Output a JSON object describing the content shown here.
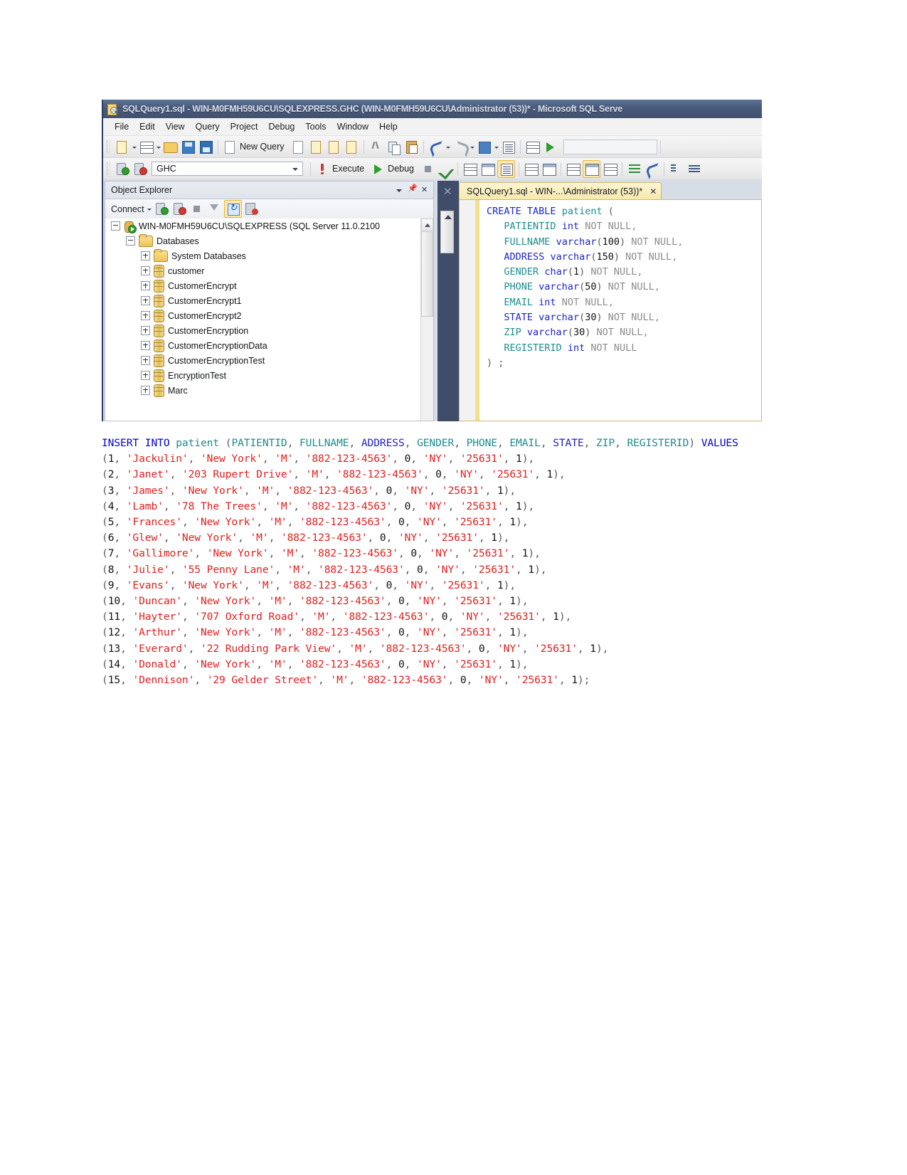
{
  "window": {
    "title": "SQLQuery1.sql - WIN-M0FMH59U6CU\\SQLEXPRESS.GHC (WIN-M0FMH59U6CU\\Administrator (53))* - Microsoft SQL Serve",
    "icon": "sql-file-icon"
  },
  "menu": {
    "items": [
      {
        "label": "File"
      },
      {
        "label": "Edit"
      },
      {
        "label": "View"
      },
      {
        "label": "Query"
      },
      {
        "label": "Project"
      },
      {
        "label": "Debug"
      },
      {
        "label": "Tools"
      },
      {
        "label": "Window"
      },
      {
        "label": "Help"
      }
    ]
  },
  "toolbar_main": {
    "new_query_label": "New Query",
    "search_value": ""
  },
  "toolbar_sql": {
    "database_combo_value": "GHC",
    "execute_label": "Execute",
    "debug_label": "Debug"
  },
  "object_explorer": {
    "title": "Object Explorer",
    "connect_label": "Connect",
    "tree": [
      {
        "label": "WIN-M0FMH59U6CU\\SQLEXPRESS (SQL Server 11.0.2100",
        "indent": 0,
        "state": "minus",
        "icon": "server-icon"
      },
      {
        "label": "Databases",
        "indent": 1,
        "state": "minus",
        "icon": "folder-icon"
      },
      {
        "label": "System Databases",
        "indent": 2,
        "state": "plus",
        "icon": "folder-icon"
      },
      {
        "label": "customer",
        "indent": 2,
        "state": "plus",
        "icon": "database-icon"
      },
      {
        "label": "CustomerEncrypt",
        "indent": 2,
        "state": "plus",
        "icon": "database-icon"
      },
      {
        "label": "CustomerEncrypt1",
        "indent": 2,
        "state": "plus",
        "icon": "database-icon"
      },
      {
        "label": "CustomerEncrypt2",
        "indent": 2,
        "state": "plus",
        "icon": "database-icon"
      },
      {
        "label": "CustomerEncryption",
        "indent": 2,
        "state": "plus",
        "icon": "database-icon"
      },
      {
        "label": "CustomerEncryptionData",
        "indent": 2,
        "state": "plus",
        "icon": "database-icon"
      },
      {
        "label": "CustomerEncryptionTest",
        "indent": 2,
        "state": "plus",
        "icon": "database-icon"
      },
      {
        "label": "EncryptionTest",
        "indent": 2,
        "state": "plus",
        "icon": "database-icon"
      },
      {
        "label": "Marc",
        "indent": 2,
        "state": "plus",
        "icon": "database-icon"
      }
    ]
  },
  "editor": {
    "tab_label": "SQLQuery1.sql - WIN-...\\Administrator (53))*",
    "tab_close": "✕",
    "create_table": {
      "line1": {
        "kw1": "CREATE",
        "kw2": "TABLE",
        "name": "patient",
        "open": "("
      },
      "columns": [
        {
          "name": "PATIENTID",
          "name_style": "id",
          "type": "int",
          "size": "",
          "null": "NOT NULL",
          "comma": ","
        },
        {
          "name": "FULLNAME",
          "name_style": "id",
          "type": "varchar",
          "size": "100",
          "null": "NOT NULL",
          "comma": ","
        },
        {
          "name": "ADDRESS",
          "name_style": "idb",
          "type": "varchar",
          "size": "150",
          "null": "NOT NULL",
          "comma": ","
        },
        {
          "name": "GENDER",
          "name_style": "id",
          "type": "char",
          "size": "1",
          "null": "NOT NULL",
          "comma": ","
        },
        {
          "name": "PHONE",
          "name_style": "id",
          "type": "varchar",
          "size": "50",
          "null": "NOT NULL",
          "comma": ","
        },
        {
          "name": "EMAIL",
          "name_style": "id",
          "type": "int",
          "size": "",
          "null": "NOT NULL",
          "comma": ","
        },
        {
          "name": "STATE",
          "name_style": "idb",
          "type": "varchar",
          "size": "30",
          "null": "NOT NULL",
          "comma": ","
        },
        {
          "name": "ZIP",
          "name_style": "id",
          "type": "varchar",
          "size": "30",
          "null": "NOT NULL",
          "comma": ","
        },
        {
          "name": "REGISTERID",
          "name_style": "id",
          "type": "int",
          "size": "",
          "null": "NOT NULL",
          "comma": ""
        }
      ],
      "closing": ") ;"
    }
  },
  "sql_listing": {
    "statement": {
      "kw_insert": "INSERT INTO",
      "table": "patient",
      "columns": [
        "PATIENTID",
        "FULLNAME",
        "ADDRESS",
        "GENDER",
        "PHONE",
        "EMAIL",
        "STATE",
        "ZIP",
        "REGISTERID"
      ],
      "column_styles": [
        "id",
        "id",
        "idb",
        "id",
        "id",
        "id",
        "idb",
        "id",
        "id"
      ],
      "kw_values": "VALUES",
      "terminator": ";"
    },
    "rows": [
      {
        "id": "1",
        "name": "Jackulin",
        "address": "New York",
        "gender": "M",
        "phone": "882-123-4563",
        "email": "0",
        "state": "NY",
        "zip": "25631",
        "registerid": "1"
      },
      {
        "id": "2",
        "name": "Janet",
        "address": "203 Rupert Drive",
        "gender": "M",
        "phone": "882-123-4563",
        "email": "0",
        "state": "NY",
        "zip": "25631",
        "registerid": "1"
      },
      {
        "id": "3",
        "name": "James",
        "address": "New York",
        "gender": "M",
        "phone": "882-123-4563",
        "email": "0",
        "state": "NY",
        "zip": "25631",
        "registerid": "1"
      },
      {
        "id": "4",
        "name": "Lamb",
        "address": "78 The Trees",
        "gender": "M",
        "phone": "882-123-4563",
        "email": "0",
        "state": "NY",
        "zip": "25631",
        "registerid": "1"
      },
      {
        "id": "5",
        "name": "Frances",
        "address": "New York",
        "gender": "M",
        "phone": "882-123-4563",
        "email": "0",
        "state": "NY",
        "zip": "25631",
        "registerid": "1"
      },
      {
        "id": "6",
        "name": "Glew",
        "address": "New York",
        "gender": "M",
        "phone": "882-123-4563",
        "email": "0",
        "state": "NY",
        "zip": "25631",
        "registerid": "1"
      },
      {
        "id": "7",
        "name": "Gallimore",
        "address": "New York",
        "gender": "M",
        "phone": "882-123-4563",
        "email": "0",
        "state": "NY",
        "zip": "25631",
        "registerid": "1"
      },
      {
        "id": "8",
        "name": "Julie",
        "address": "55 Penny Lane",
        "gender": "M",
        "phone": "882-123-4563",
        "email": "0",
        "state": "NY",
        "zip": "25631",
        "registerid": "1"
      },
      {
        "id": "9",
        "name": "Evans",
        "address": "New York",
        "gender": "M",
        "phone": "882-123-4563",
        "email": "0",
        "state": "NY",
        "zip": "25631",
        "registerid": "1"
      },
      {
        "id": "10",
        "name": "Duncan",
        "address": "New York",
        "gender": "M",
        "phone": "882-123-4563",
        "email": "0",
        "state": "NY",
        "zip": "25631",
        "registerid": "1"
      },
      {
        "id": "11",
        "name": "Hayter",
        "address": "707 Oxford Road",
        "gender": "M",
        "phone": "882-123-4563",
        "email": "0",
        "state": "NY",
        "zip": "25631",
        "registerid": "1"
      },
      {
        "id": "12",
        "name": "Arthur",
        "address": "New York",
        "gender": "M",
        "phone": "882-123-4563",
        "email": "0",
        "state": "NY",
        "zip": "25631",
        "registerid": "1"
      },
      {
        "id": "13",
        "name": "Everard",
        "address": "22 Rudding Park View",
        "gender": "M",
        "phone": "882-123-4563",
        "email": "0",
        "state": "NY",
        "zip": "25631",
        "registerid": "1"
      },
      {
        "id": "14",
        "name": "Donald",
        "address": "New York",
        "gender": "M",
        "phone": "882-123-4563",
        "email": "0",
        "state": "NY",
        "zip": "25631",
        "registerid": "1"
      },
      {
        "id": "15",
        "name": "Dennison",
        "address": "29 Gelder Street",
        "gender": "M",
        "phone": "882-123-4563",
        "email": "0",
        "state": "NY",
        "zip": "25631",
        "registerid": "1"
      }
    ]
  },
  "colors": {
    "keyword": "#1b25c8",
    "identifier": "#1c8c8c",
    "string": "#e02020",
    "comment_gray": "#8c8c8c",
    "tab_active": "#f6e9ac",
    "titlebar": "#48597a"
  }
}
